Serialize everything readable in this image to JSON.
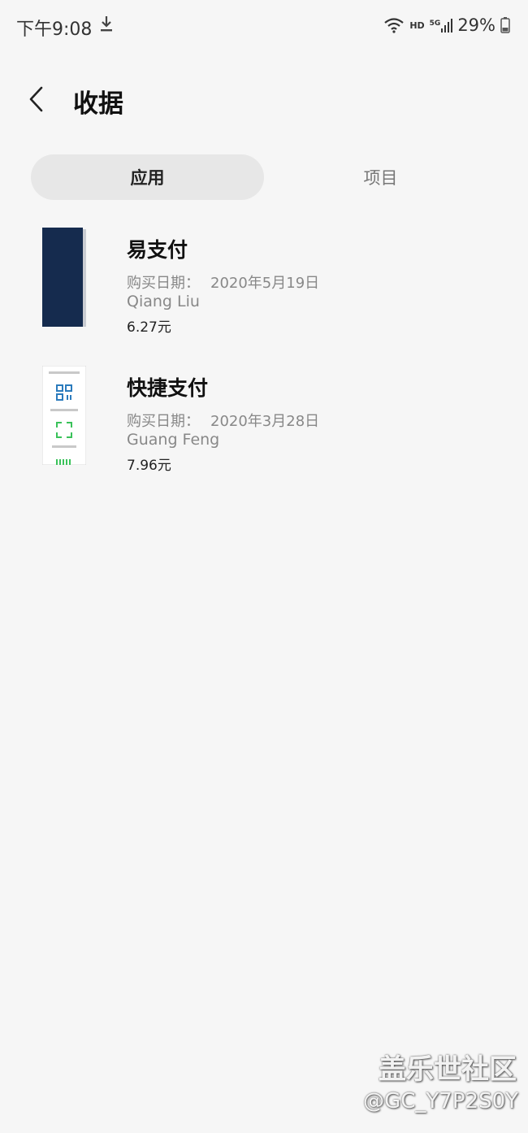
{
  "status_bar": {
    "time": "下午9:08",
    "hd": "HD",
    "network": "5G",
    "battery": "29%"
  },
  "header": {
    "title": "收据"
  },
  "tabs": [
    {
      "label": "应用",
      "active": true
    },
    {
      "label": "项目",
      "active": false
    }
  ],
  "items": [
    {
      "title": "易支付",
      "date_label": "购买日期：",
      "date": "2020年5月19日",
      "name": "Qiang Liu",
      "price": "6.27元"
    },
    {
      "title": "快捷支付",
      "date_label": "购买日期：",
      "date": "2020年3月28日",
      "name": "Guang Feng",
      "price": "7.96元"
    }
  ],
  "watermark": {
    "line1": "盖乐世社区",
    "line2": "@GC_Y7P2S0Y"
  },
  "colors": {
    "background": "#f6f6f6",
    "active_tab_bg": "#e7e7e7",
    "thumb_dark": "#152b4e",
    "qr_blue": "#2b7bbd",
    "scan_green": "#3ac25a"
  }
}
